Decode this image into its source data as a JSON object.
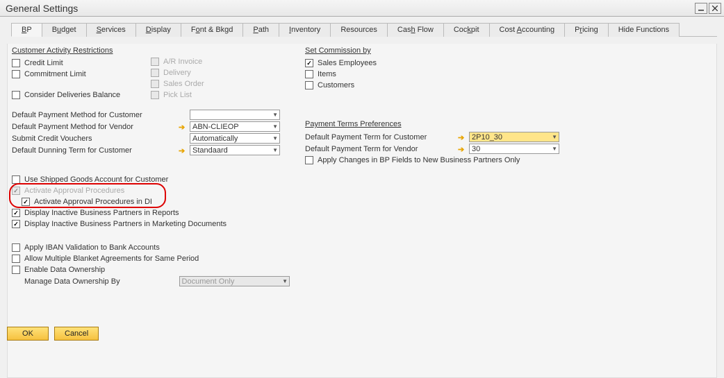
{
  "window": {
    "title": "General Settings",
    "min_tooltip": "Minimize",
    "close_tooltip": "Close"
  },
  "tabs": [
    "BP",
    "Budget",
    "Services",
    "Display",
    "Font & Bkgd",
    "Path",
    "Inventory",
    "Resources",
    "Cash Flow",
    "Cockpit",
    "Cost Accounting",
    "Pricing",
    "Hide Functions"
  ],
  "activeTab": 0,
  "left": {
    "car_header": "Customer Activity Restrictions",
    "credit_limit": "Credit Limit",
    "commitment_limit": "Commitment Limit",
    "ar_invoice": "A/R Invoice",
    "delivery": "Delivery",
    "sales_order": "Sales Order",
    "pick_list": "Pick List",
    "consider_deliveries": "Consider Deliveries Balance",
    "pm_customer": "Default Payment Method for Customer",
    "pm_vendor": "Default Payment Method for Vendor",
    "pm_vendor_val": "ABN-CLIEOP",
    "submit_credit": "Submit Credit Vouchers",
    "submit_credit_val": "Automatically",
    "dunning": "Default Dunning Term for Customer",
    "dunning_val": "Standaard",
    "use_shipped": "Use Shipped Goods Account for Customer",
    "activate_approval": "Activate Approval Procedures",
    "activate_approval_di": "Activate Approval Procedures in DI",
    "display_inactive_reports": "Display Inactive Business Partners in Reports",
    "display_inactive_marketing": "Display Inactive Business Partners in Marketing Documents",
    "apply_iban": "Apply IBAN Validation to Bank Accounts",
    "allow_blanket": "Allow Multiple Blanket Agreements for Same Period",
    "enable_data_own": "Enable Data Ownership",
    "manage_data_own": "Manage Data Ownership By",
    "manage_data_own_val": "Document Only"
  },
  "right": {
    "commission_header": "Set Commission by",
    "sales_emp": "Sales Employees",
    "items": "Items",
    "customers": "Customers",
    "pt_header": "Payment Terms Preferences",
    "pt_customer": "Default Payment Term for Customer",
    "pt_customer_val": "2P10_30",
    "pt_vendor": "Default Payment Term for Vendor",
    "pt_vendor_val": "30",
    "apply_changes": "Apply Changes in BP Fields to New Business Partners Only"
  },
  "footer": {
    "ok": "OK",
    "cancel": "Cancel"
  }
}
